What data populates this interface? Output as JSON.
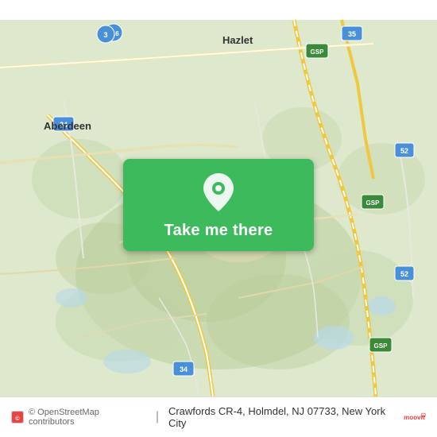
{
  "map": {
    "center_location": "Crawfords CR-4, Holmdel, NJ",
    "zoom": 12,
    "attribution": "© OpenStreetMap contributors",
    "city": "New York City"
  },
  "button": {
    "label": "Take me there",
    "pin_icon": "location-pin"
  },
  "bottom_bar": {
    "attribution": "© OpenStreetMap contributors",
    "address": "Crawfords CR-4, Holmdel, NJ 07733, New York City",
    "app_name": "moovit"
  },
  "labels": {
    "aberdeen": "Aberdeen",
    "hazlet": "Hazlet",
    "cr516": "CR 516",
    "nj35": "NJ 35",
    "nj34_top": "NJ 34",
    "nj34_bottom": "NJ 34",
    "gsp_top": "GSP",
    "gsp_mid": "GSP",
    "gsp_bottom": "GSP",
    "n52_top": "(52)",
    "n52_bottom": "(52)",
    "n3": "(3)"
  },
  "colors": {
    "map_green": "#c8d8b0",
    "map_light_green": "#dce8c8",
    "road_yellow": "#f5e8a0",
    "road_white": "#ffffff",
    "road_gray": "#d0d0d0",
    "water_blue": "#a8c8e8",
    "button_green": "#3dba5c",
    "text_dark": "#333333",
    "text_gray": "#666666"
  }
}
